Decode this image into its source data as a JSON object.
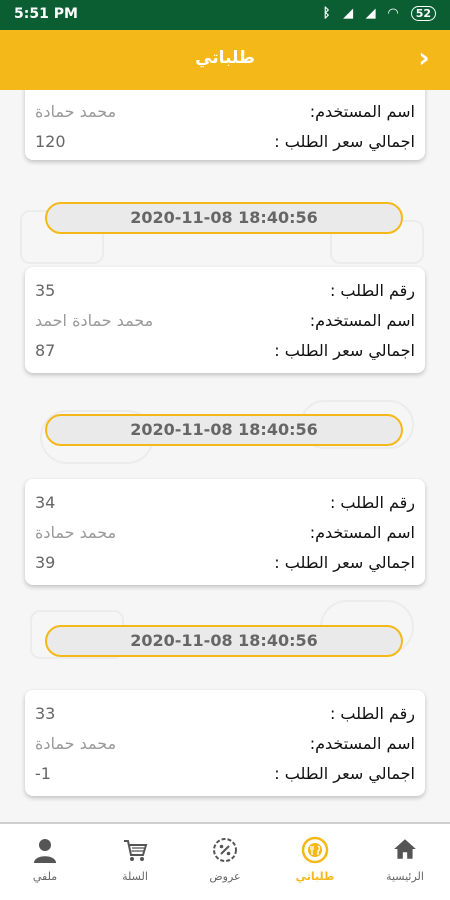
{
  "status_bar": {
    "time": "5:51 PM",
    "battery": "52"
  },
  "header": {
    "title": "طلباتي"
  },
  "labels": {
    "order_number": "رقم الطلب :",
    "user_name": "اسم المستخدم:",
    "total_price": "اجمالي سعر الطلب :"
  },
  "orders": [
    {
      "user_name": "محمد حمادة",
      "total": "120"
    },
    {
      "date": "2020-11-08 18:40:56",
      "order_number": "35",
      "user_name": "محمد حمادة احمد",
      "total": "87"
    },
    {
      "date": "2020-11-08 18:40:56",
      "order_number": "34",
      "user_name": "محمد حمادة",
      "total": "39"
    },
    {
      "date": "2020-11-08 18:40:56",
      "order_number": "33",
      "user_name": "محمد حمادة",
      "total": "-1"
    }
  ],
  "bottom_nav": [
    {
      "label": "الرئيسية",
      "icon": "home-icon"
    },
    {
      "label": "طلباتي",
      "icon": "orders-icon",
      "active": true
    },
    {
      "label": "عروض",
      "icon": "offers-icon"
    },
    {
      "label": "السلة",
      "icon": "cart-icon"
    },
    {
      "label": "ملفي",
      "icon": "profile-icon"
    }
  ],
  "colors": {
    "accent": "#f5b819",
    "status_bar": "#0b5e32"
  }
}
